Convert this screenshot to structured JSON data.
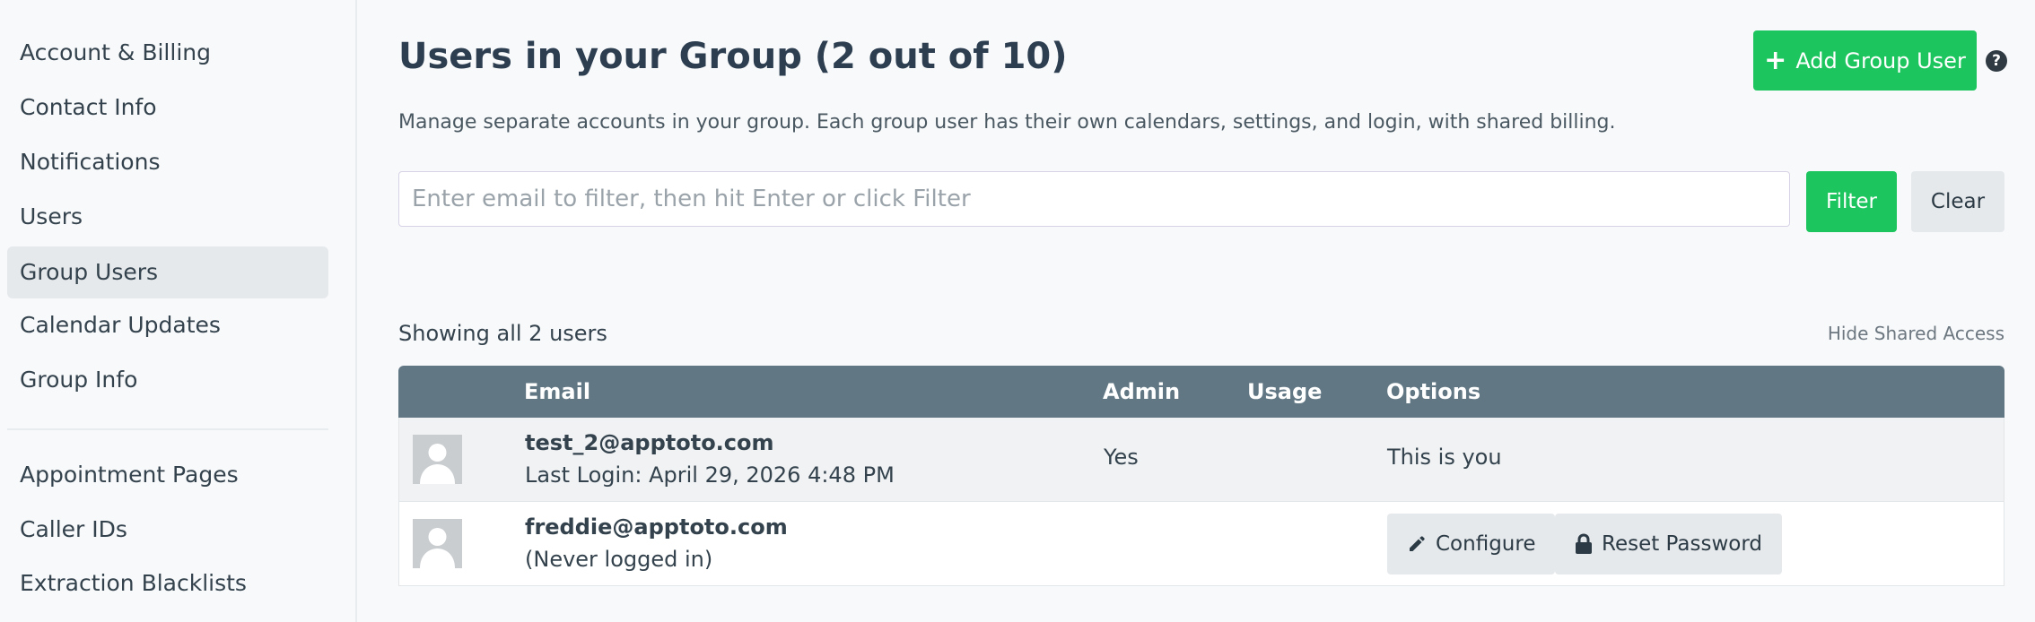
{
  "sidebar": {
    "items": [
      {
        "label": "Account & Billing"
      },
      {
        "label": "Contact Info"
      },
      {
        "label": "Notifications"
      },
      {
        "label": "Users"
      },
      {
        "label": "Group Users",
        "active": true
      },
      {
        "label": "Calendar Updates"
      },
      {
        "label": "Group Info"
      },
      {
        "label": "Appointment Pages"
      },
      {
        "label": "Caller IDs"
      },
      {
        "label": "Extraction Blacklists"
      }
    ]
  },
  "header": {
    "title": "Users in your Group (2 out of 10)",
    "description": "Manage separate accounts in your group. Each group user has their own calendars, settings, and login, with shared billing.",
    "add_button_label": "Add Group User",
    "help_icon": "question-circle-icon"
  },
  "filter": {
    "placeholder": "Enter email to filter, then hit Enter or click Filter",
    "value": "",
    "filter_label": "Filter",
    "clear_label": "Clear"
  },
  "summary": {
    "showing_text": "Showing all 2 users",
    "hide_shared_label": "Hide Shared Access"
  },
  "table": {
    "columns": [
      "Email",
      "Admin",
      "Usage",
      "Options"
    ],
    "rows": [
      {
        "email": "test_2@apptoto.com",
        "login": "Last Login: April 29, 2026 4:48 PM",
        "admin": "Yes",
        "usage": "",
        "options_text": "This is you"
      },
      {
        "email": "freddie@apptoto.com",
        "login": "(Never logged in)",
        "admin": "",
        "usage": "",
        "configure_label": "Configure",
        "reset_label": "Reset Password"
      }
    ]
  },
  "colors": {
    "primary_green": "#1dc55f",
    "table_header": "#617784",
    "active_nav": "#e6e9ec"
  }
}
